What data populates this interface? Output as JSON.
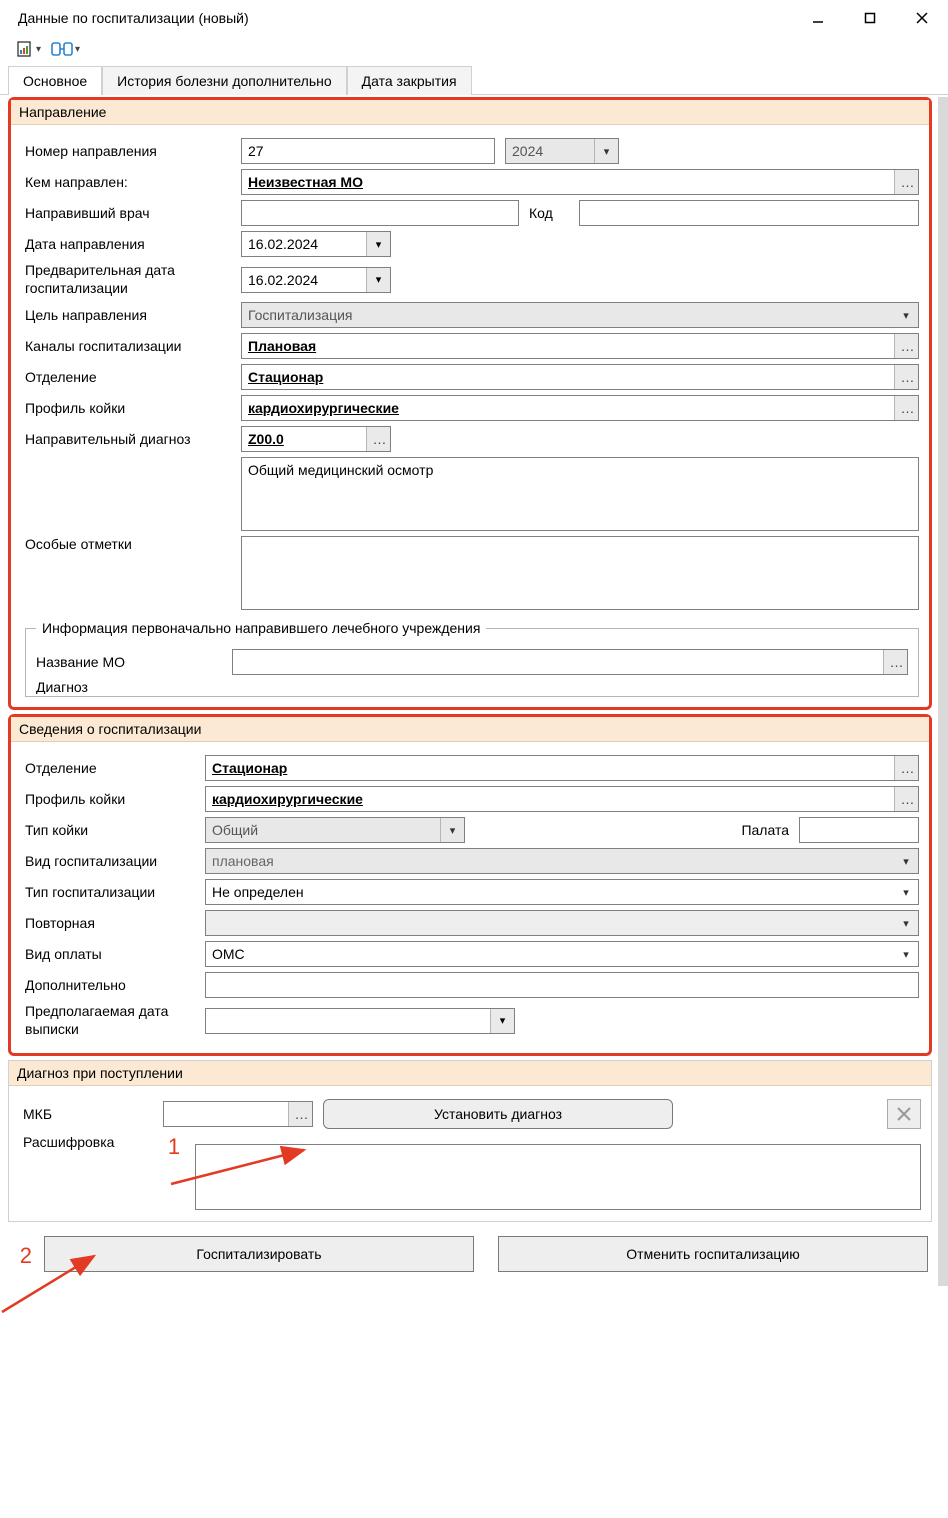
{
  "window": {
    "title": "Данные по госпитализации (новый)"
  },
  "tabs": {
    "main": "Основное",
    "history": "История болезни дополнительно",
    "close_date": "Дата закрытия"
  },
  "referral": {
    "title": "Направление",
    "number_label": "Номер направления",
    "number_value": "27",
    "year": "2024",
    "sent_by_label": "Кем направлен:",
    "sent_by_value": "Неизвестная МО",
    "doctor_label": "Направивший врач",
    "doctor_value": "",
    "code_label": "Код",
    "code_value": "",
    "date_label": "Дата направления",
    "date_value": "16.02.2024",
    "prelim_date_label": "Предварительная дата госпитализации",
    "prelim_date_value": "16.02.2024",
    "goal_label": "Цель направления",
    "goal_value": "Госпитализация",
    "channel_label": "Каналы госпитализации",
    "channel_value": "Плановая",
    "dept_label": "Отделение",
    "dept_value": "Стационар",
    "bed_profile_label": "Профиль койки",
    "bed_profile_value": "кардиохирургические",
    "diag_label": "Направительный диагноз",
    "diag_code": "Z00.0",
    "diag_text": "Общий медицинский осмотр",
    "notes_label": "Особые отметки",
    "notes_value": "",
    "orig_group_title": "Информация первоначально направившего лечебного учреждения",
    "orig_name_label": "Название МО",
    "orig_name_value": "",
    "orig_diag_label_cut": "Диагноз"
  },
  "hosp": {
    "title": "Сведения о госпитализации",
    "dept_label": "Отделение",
    "dept_value": "Стационар",
    "bed_profile_label": "Профиль койки",
    "bed_profile_value": "кардиохирургические",
    "bed_type_label": "Тип койки",
    "bed_type_value": "Общий",
    "ward_label": "Палата",
    "ward_value": "",
    "kind_label": "Вид госпитализации",
    "kind_value": "плановая",
    "type_label": "Тип госпитализации",
    "type_value": "Не определен",
    "repeat_label": "Повторная",
    "repeat_value": "",
    "payment_label": "Вид оплаты",
    "payment_value": "ОМС",
    "extra_label": "Дополнительно",
    "extra_value": "",
    "discharge_label": "Предполагаемая дата выписки",
    "discharge_value": ""
  },
  "admit_diag": {
    "title": "Диагноз при поступлении",
    "mkb_label": "МКБ",
    "mkb_value": "",
    "set_btn": "Установить диагноз",
    "desc_label": "Расшифровка",
    "desc_value": ""
  },
  "actions": {
    "hospitalize": "Госпитализировать",
    "cancel": "Отменить госпитализацию"
  },
  "annot": {
    "one": "1",
    "two": "2"
  }
}
